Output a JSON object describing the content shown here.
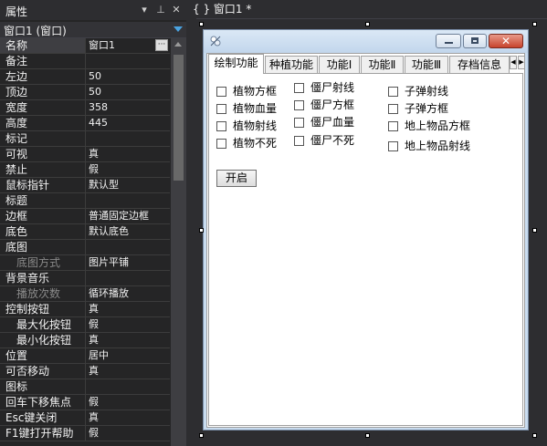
{
  "property_panel": {
    "title": "属性",
    "object_selector": "窗口1 (窗口)",
    "properties": [
      {
        "name": "名称",
        "value": "窗口1"
      },
      {
        "name": "备注",
        "value": ""
      },
      {
        "name": "左边",
        "value": "50"
      },
      {
        "name": "顶边",
        "value": "50"
      },
      {
        "name": "宽度",
        "value": "358"
      },
      {
        "name": "高度",
        "value": "445"
      },
      {
        "name": "标记",
        "value": ""
      },
      {
        "name": "可视",
        "value": "真"
      },
      {
        "name": "禁止",
        "value": "假"
      },
      {
        "name": "鼠标指针",
        "value": "默认型"
      },
      {
        "name": "标题",
        "value": ""
      },
      {
        "name": "边框",
        "value": "普通固定边框"
      },
      {
        "name": "底色",
        "value": "默认底色"
      },
      {
        "name": "底图",
        "value": ""
      },
      {
        "name": "底图方式",
        "value": "图片平铺"
      },
      {
        "name": "背景音乐",
        "value": ""
      },
      {
        "name": "播放次数",
        "value": "循环播放"
      },
      {
        "name": "控制按钮",
        "value": "真"
      },
      {
        "name": "最大化按钮",
        "value": "假"
      },
      {
        "name": "最小化按钮",
        "value": "真"
      },
      {
        "name": "位置",
        "value": "居中"
      },
      {
        "name": "可否移动",
        "value": "真"
      },
      {
        "name": "图标",
        "value": ""
      },
      {
        "name": "回车下移焦点",
        "value": "假"
      },
      {
        "name": "Esc键关闭",
        "value": "真"
      },
      {
        "name": "F1键打开帮助",
        "value": "假"
      }
    ],
    "ellipsis_label": "···"
  },
  "designer": {
    "doc_tab": "{ } 窗口1 *",
    "form": {
      "tabs": [
        "绘制功能",
        "种植功能",
        "功能Ⅰ",
        "功能Ⅱ",
        "功能Ⅲ",
        "存档信息"
      ],
      "active_tab": "绘制功能",
      "checkboxes_col1": [
        "植物方框",
        "植物血量",
        "植物射线",
        "植物不死"
      ],
      "checkboxes_col2": [
        "僵尸射线",
        "僵尸方框",
        "僵尸血量",
        "僵尸不死"
      ],
      "checkboxes_col3": [
        "子弹射线",
        "子弹方框",
        "地上物品方框",
        "地上物品射线"
      ],
      "start_button": "开启"
    }
  }
}
